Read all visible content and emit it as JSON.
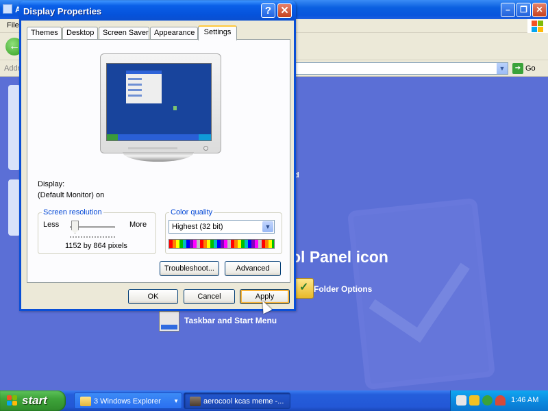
{
  "background_window": {
    "title": "A",
    "menu_file": "File",
    "address_label": "Addr",
    "go_label": "Go",
    "heading_tail": "ol Panel icon",
    "small_tail": "d",
    "tasks": {
      "folder_options": "Folder Options",
      "taskbar_start_menu": "Taskbar and Start Menu"
    },
    "control_icons": [
      "minimize-icon",
      "restore-icon",
      "close-icon"
    ]
  },
  "dialog": {
    "title": "Display Properties",
    "help_glyph": "?",
    "close_glyph": "✕",
    "tabs": [
      "Themes",
      "Desktop",
      "Screen Saver",
      "Appearance",
      "Settings"
    ],
    "active_tab": "Settings",
    "display_label": "Display:",
    "display_value": "(Default Monitor) on",
    "screen_resolution": {
      "legend": "Screen resolution",
      "less": "Less",
      "more": "More",
      "value_text": "1152 by 864 pixels",
      "slider_level": 0.1
    },
    "color_quality": {
      "legend": "Color quality",
      "selected": "Highest (32 bit)"
    },
    "buttons": {
      "troubleshoot": "Troubleshoot...",
      "advanced": "Advanced",
      "ok": "OK",
      "cancel": "Cancel",
      "apply": "Apply"
    }
  },
  "taskbar": {
    "start_label": "start",
    "items": [
      {
        "label": "3 Windows Explorer",
        "icon": "folder-icon"
      },
      {
        "label": "aerocool kcas meme -...",
        "icon": "app-icon"
      }
    ],
    "tray_icons": [
      "network-icon",
      "security-shield-icon",
      "update-icon",
      "antivirus-icon"
    ],
    "clock": "1:46 AM"
  },
  "colors": {
    "titlebar_blue": "#0a5fe8",
    "close_red": "#c5421f",
    "desktop_blue": "#5b6fd6",
    "start_green": "#3ea43a",
    "tray_blue": "#0b8be0",
    "dialog_face": "#ece9d8"
  }
}
